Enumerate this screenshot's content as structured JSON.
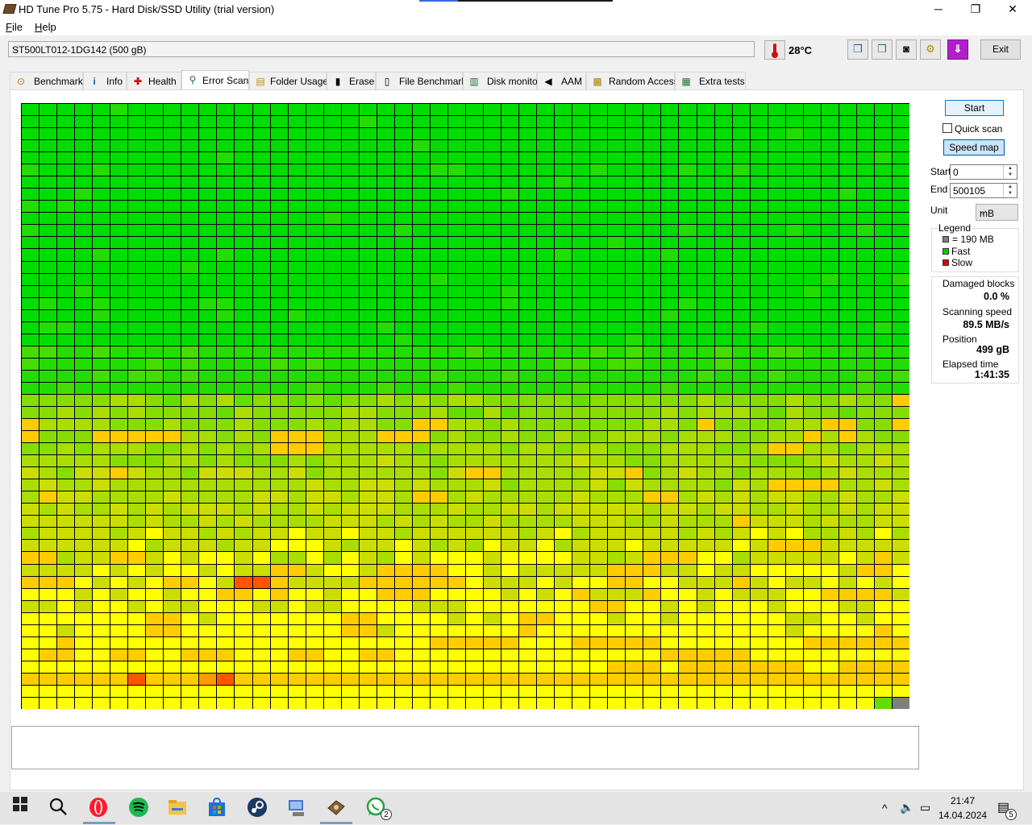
{
  "window": {
    "title": "HD Tune Pro 5.75 - Hard Disk/SSD Utility (trial version)",
    "controls": {
      "minimize": "─",
      "maximize": "❐",
      "close": "✕"
    }
  },
  "menu": {
    "file": "File",
    "help": "Help"
  },
  "toolbar": {
    "drive": "ST500LT012-1DG142 (500 gB)",
    "temperature": "28°C",
    "exit_label": "Exit",
    "icons": [
      "copy-text-icon",
      "copy-info-icon",
      "screenshot-icon",
      "options-icon",
      "save-icon"
    ]
  },
  "tabs": [
    {
      "label": "Benchmark",
      "icon": "benchmark-icon",
      "glyph": "⊙"
    },
    {
      "label": "Info",
      "icon": "info-icon",
      "glyph": "i"
    },
    {
      "label": "Health",
      "icon": "health-icon",
      "glyph": "✚"
    },
    {
      "label": "Error Scan",
      "icon": "error-scan-icon",
      "glyph": "🔍"
    },
    {
      "label": "Folder Usage",
      "icon": "folder-icon",
      "glyph": "▤"
    },
    {
      "label": "Erase",
      "icon": "erase-icon",
      "glyph": "🗑"
    },
    {
      "label": "File Benchmark",
      "icon": "file-benchmark-icon",
      "glyph": "▦"
    },
    {
      "label": "Disk monitor",
      "icon": "disk-monitor-icon",
      "glyph": "▥"
    },
    {
      "label": "AAM",
      "icon": "speaker-icon",
      "glyph": "◀"
    },
    {
      "label": "Random Access",
      "icon": "random-access-icon",
      "glyph": "▩"
    },
    {
      "label": "Extra tests",
      "icon": "extra-tests-icon",
      "glyph": "▦"
    }
  ],
  "scan": {
    "start_button": "Start",
    "quick_scan_label": "Quick scan",
    "quick_scan_checked": false,
    "speed_map_button": "Speed map",
    "start_label": "Start",
    "start_value": "0",
    "end_label": "End",
    "end_value": "500105",
    "unit_label": "Unit",
    "unit_value": "mB",
    "legend_title": "Legend",
    "legend": [
      {
        "label": "= 190 MB",
        "color": "#7f7f7f"
      },
      {
        "label": "Fast",
        "color": "#00d000"
      },
      {
        "label": "Slow",
        "color": "#e00000"
      }
    ],
    "damaged_blocks_label": "Damaged blocks",
    "damaged_blocks_value": "0.0 %",
    "scanning_speed_label": "Scanning speed",
    "scanning_speed_value": "89.5 MB/s",
    "position_label": "Position",
    "position_value": "499 gB",
    "elapsed_label": "Elapsed time",
    "elapsed_value": "1:41:35"
  },
  "speed_map": {
    "cols": 50,
    "rows": 50,
    "palette": [
      "#00dd00",
      "#22dd00",
      "#44dd00",
      "#66dd00",
      "#88dd00",
      "#aadd00",
      "#ccdd00",
      "#ffff00",
      "#ffcc00",
      "#ff9900",
      "#ff5500",
      "#7f7f7f"
    ],
    "orange_cells": [
      [
        24,
        49
      ],
      [
        26,
        0
      ],
      [
        26,
        22
      ],
      [
        26,
        23
      ],
      [
        26,
        38
      ],
      [
        26,
        45
      ],
      [
        26,
        46
      ],
      [
        26,
        49
      ],
      [
        27,
        0
      ],
      [
        27,
        4
      ],
      [
        27,
        5
      ],
      [
        27,
        6
      ],
      [
        27,
        7
      ],
      [
        27,
        8
      ],
      [
        27,
        14
      ],
      [
        27,
        15
      ],
      [
        27,
        16
      ],
      [
        27,
        20
      ],
      [
        27,
        21
      ],
      [
        27,
        22
      ],
      [
        27,
        44
      ],
      [
        27,
        46
      ],
      [
        28,
        14
      ],
      [
        28,
        15
      ],
      [
        28,
        16
      ],
      [
        28,
        42
      ],
      [
        28,
        43
      ],
      [
        30,
        5
      ],
      [
        30,
        25
      ],
      [
        30,
        26
      ],
      [
        30,
        34
      ],
      [
        31,
        42
      ],
      [
        31,
        43
      ],
      [
        31,
        44
      ],
      [
        31,
        45
      ],
      [
        32,
        1
      ],
      [
        32,
        22
      ],
      [
        32,
        23
      ],
      [
        32,
        35
      ],
      [
        32,
        36
      ],
      [
        34,
        40
      ],
      [
        36,
        42
      ],
      [
        36,
        43
      ],
      [
        36,
        44
      ],
      [
        37,
        0
      ],
      [
        37,
        1
      ],
      [
        37,
        5
      ],
      [
        37,
        6
      ],
      [
        37,
        35
      ],
      [
        37,
        36
      ],
      [
        37,
        37
      ],
      [
        37,
        48
      ],
      [
        38,
        14
      ],
      [
        38,
        15
      ],
      [
        38,
        20
      ],
      [
        38,
        21
      ],
      [
        38,
        22
      ],
      [
        38,
        23
      ],
      [
        38,
        33
      ],
      [
        38,
        34
      ],
      [
        38,
        35
      ],
      [
        38,
        47
      ],
      [
        38,
        48
      ],
      [
        39,
        0
      ],
      [
        39,
        1
      ],
      [
        39,
        2
      ],
      [
        39,
        8
      ],
      [
        39,
        9
      ],
      [
        39,
        12
      ],
      [
        39,
        13
      ],
      [
        39,
        14
      ],
      [
        39,
        19
      ],
      [
        39,
        20
      ],
      [
        39,
        21
      ],
      [
        39,
        22
      ],
      [
        39,
        23
      ],
      [
        39,
        24
      ],
      [
        39,
        33
      ],
      [
        39,
        34
      ],
      [
        39,
        40
      ],
      [
        40,
        11
      ],
      [
        40,
        12
      ],
      [
        40,
        14
      ],
      [
        40,
        20
      ],
      [
        40,
        21
      ],
      [
        40,
        22
      ],
      [
        40,
        31
      ],
      [
        40,
        35
      ],
      [
        40,
        45
      ],
      [
        40,
        46
      ],
      [
        40,
        47
      ],
      [
        40,
        48
      ],
      [
        41,
        32
      ],
      [
        41,
        33
      ],
      [
        42,
        7
      ],
      [
        42,
        8
      ],
      [
        42,
        18
      ],
      [
        42,
        19
      ],
      [
        42,
        28
      ],
      [
        42,
        29
      ],
      [
        43,
        7
      ],
      [
        43,
        8
      ],
      [
        43,
        18
      ],
      [
        43,
        19
      ],
      [
        43,
        28
      ],
      [
        43,
        48
      ],
      [
        44,
        2
      ],
      [
        44,
        23
      ],
      [
        44,
        24
      ],
      [
        44,
        25
      ],
      [
        44,
        26
      ],
      [
        44,
        27
      ],
      [
        44,
        31
      ],
      [
        44,
        32
      ],
      [
        44,
        33
      ],
      [
        44,
        34
      ],
      [
        44,
        35
      ],
      [
        44,
        44
      ],
      [
        44,
        45
      ],
      [
        44,
        46
      ],
      [
        44,
        47
      ],
      [
        44,
        48
      ],
      [
        44,
        49
      ],
      [
        45,
        1
      ],
      [
        45,
        2
      ],
      [
        45,
        5
      ],
      [
        45,
        6
      ],
      [
        45,
        9
      ],
      [
        45,
        10
      ],
      [
        45,
        11
      ],
      [
        45,
        15
      ],
      [
        45,
        16
      ],
      [
        45,
        19
      ],
      [
        45,
        20
      ],
      [
        45,
        36
      ],
      [
        45,
        37
      ],
      [
        45,
        38
      ],
      [
        45,
        39
      ],
      [
        45,
        40
      ],
      [
        46,
        33
      ],
      [
        46,
        34
      ],
      [
        46,
        35
      ],
      [
        46,
        37
      ],
      [
        46,
        38
      ],
      [
        46,
        39
      ],
      [
        46,
        40
      ],
      [
        46,
        41
      ],
      [
        46,
        42
      ],
      [
        46,
        43
      ],
      [
        46,
        46
      ],
      [
        46,
        47
      ],
      [
        46,
        48
      ],
      [
        46,
        49
      ],
      [
        47,
        0
      ],
      [
        47,
        1
      ],
      [
        47,
        2
      ],
      [
        47,
        3
      ],
      [
        47,
        4
      ],
      [
        47,
        5
      ],
      [
        47,
        6
      ],
      [
        47,
        7
      ],
      [
        47,
        8
      ],
      [
        47,
        9
      ],
      [
        47,
        10
      ],
      [
        47,
        11
      ],
      [
        47,
        12
      ],
      [
        47,
        13
      ],
      [
        47,
        14
      ],
      [
        47,
        15
      ],
      [
        47,
        16
      ],
      [
        47,
        17
      ],
      [
        47,
        18
      ],
      [
        47,
        19
      ],
      [
        47,
        20
      ],
      [
        47,
        21
      ],
      [
        47,
        22
      ],
      [
        47,
        23
      ],
      [
        47,
        24
      ],
      [
        47,
        25
      ],
      [
        47,
        26
      ],
      [
        47,
        27
      ],
      [
        47,
        28
      ],
      [
        47,
        29
      ],
      [
        47,
        30
      ],
      [
        47,
        31
      ],
      [
        47,
        32
      ],
      [
        47,
        33
      ],
      [
        47,
        34
      ],
      [
        47,
        35
      ],
      [
        47,
        36
      ],
      [
        47,
        37
      ],
      [
        47,
        38
      ],
      [
        47,
        39
      ],
      [
        47,
        40
      ],
      [
        47,
        41
      ],
      [
        47,
        42
      ],
      [
        47,
        43
      ],
      [
        47,
        44
      ],
      [
        47,
        45
      ],
      [
        47,
        46
      ],
      [
        47,
        47
      ],
      [
        47,
        48
      ],
      [
        47,
        49
      ]
    ],
    "red_cells": [
      [
        39,
        12
      ],
      [
        39,
        13
      ],
      [
        47,
        6
      ],
      [
        47,
        10
      ],
      [
        47,
        11
      ]
    ],
    "last_cell_gray": [
      49,
      49
    ]
  },
  "taskbar": {
    "icons": [
      "windows-start-icon",
      "search-icon",
      "opera-icon",
      "spotify-icon",
      "file-explorer-icon",
      "microsoft-store-icon",
      "steam-icon",
      "network-app-icon",
      "hd-tune-icon",
      "whatsapp-icon"
    ],
    "whatsapp_badge": "2",
    "time": "21:47",
    "date": "14.04.2024",
    "notification_badge": "5"
  }
}
